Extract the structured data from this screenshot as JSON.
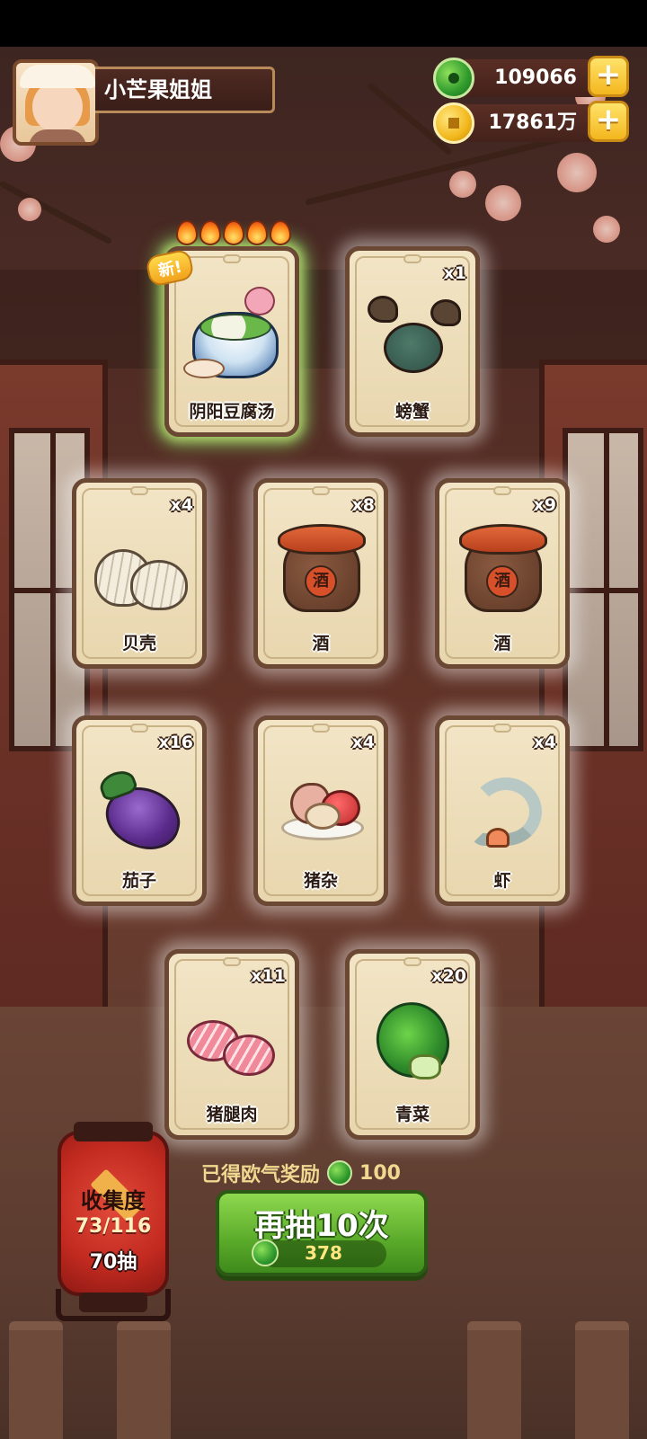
{
  "player": {
    "name": "小芒果姐姐"
  },
  "currencies": [
    {
      "icon": "jade-icon",
      "value": "109066"
    },
    {
      "icon": "coin-icon",
      "value": "17861万"
    }
  ],
  "plus_label": "+",
  "featured": {
    "tag": "新!",
    "stars": 5
  },
  "cards": [
    {
      "name": "阴阳豆腐汤",
      "count": "",
      "art": "soup"
    },
    {
      "name": "螃蟹",
      "count": "x1",
      "art": "crab"
    },
    {
      "name": "贝壳",
      "count": "x4",
      "art": "shell"
    },
    {
      "name": "酒",
      "count": "x8",
      "art": "wine"
    },
    {
      "name": "酒",
      "count": "x9",
      "art": "wine"
    },
    {
      "name": "茄子",
      "count": "x16",
      "art": "eggplant"
    },
    {
      "name": "猪杂",
      "count": "x4",
      "art": "offal"
    },
    {
      "name": "虾",
      "count": "x4",
      "art": "shrimp"
    },
    {
      "name": "猪腿肉",
      "count": "x11",
      "art": "pork"
    },
    {
      "name": "青菜",
      "count": "x20",
      "art": "greens"
    }
  ],
  "wine_glyph": "酒",
  "collection": {
    "title": "收集度",
    "progress": "73/116",
    "draws": "70抽"
  },
  "luck_reward": {
    "label": "已得欧气奖励",
    "value": "100"
  },
  "draw_button": {
    "label": "再抽10次",
    "cost": "378"
  }
}
